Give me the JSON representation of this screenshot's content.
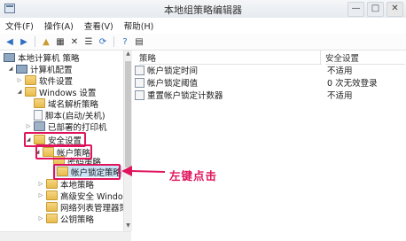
{
  "window": {
    "title": "本地组策略编辑器",
    "buttons": {
      "minimize": "—",
      "maximize": "□",
      "close": "✕"
    }
  },
  "menu": [
    {
      "label": "文件(F)"
    },
    {
      "label": "操作(A)"
    },
    {
      "label": "查看(V)"
    },
    {
      "label": "帮助(H)"
    }
  ],
  "toolbar": {
    "back": "◀",
    "forward": "▶",
    "up": "▲",
    "show_hide": "▦",
    "delete": "✕",
    "properties": "☰",
    "refresh": "⟳",
    "help": "?",
    "view": "▤"
  },
  "tree": [
    {
      "label": "本地计算机 策略",
      "expander": "",
      "icon": "pc"
    },
    {
      "label": "计算机配置",
      "expander": "◢",
      "icon": "pc"
    },
    {
      "label": "软件设置",
      "expander": "▷",
      "icon": "folder"
    },
    {
      "label": "Windows 设置",
      "expander": "◢",
      "icon": "folder"
    },
    {
      "label": "域名解析策略",
      "expander": "",
      "icon": "folder"
    },
    {
      "label": "脚本(启动/关机)",
      "expander": "",
      "icon": "doc"
    },
    {
      "label": "已部署的打印机",
      "expander": "▷",
      "icon": "folder"
    },
    {
      "label": "安全设置",
      "expander": "◢",
      "icon": "folder"
    },
    {
      "label": "帐户策略",
      "expander": "◢",
      "icon": "folder"
    },
    {
      "label": "密码策略",
      "expander": "",
      "icon": "folder"
    },
    {
      "label": "帐户锁定策略",
      "expander": "",
      "icon": "folder"
    },
    {
      "label": "本地策略",
      "expander": "▷",
      "icon": "folder"
    },
    {
      "label": "高级安全 Windov",
      "expander": "▷",
      "icon": "folder"
    },
    {
      "label": "网络列表管理器策",
      "expander": "",
      "icon": "folder"
    },
    {
      "label": "公钥策略",
      "expander": "▷",
      "icon": "folder"
    }
  ],
  "list": {
    "columns": {
      "policy": "策略",
      "setting": "安全设置"
    },
    "rows": [
      {
        "policy": "帐户锁定时间",
        "setting": "不适用"
      },
      {
        "policy": "帐户锁定阈值",
        "setting": "0 次无效登录"
      },
      {
        "policy": "重置帐户锁定计数器",
        "setting": "不适用"
      }
    ]
  },
  "annotation": {
    "text": "左键点击"
  },
  "colors": {
    "highlight": "#e0145c",
    "selection": "#cce4f7"
  }
}
